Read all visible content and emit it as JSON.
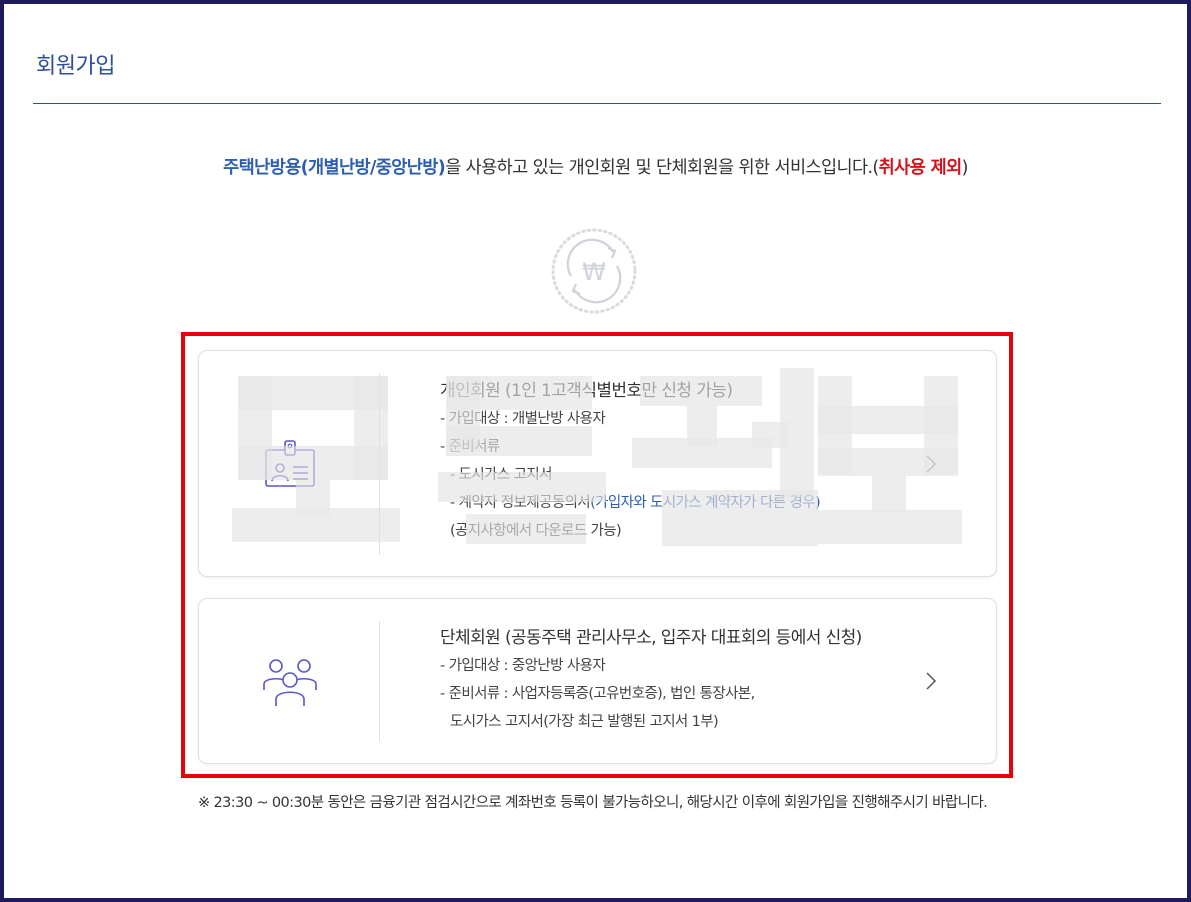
{
  "page": {
    "title": "회원가입"
  },
  "intro": {
    "highlight_blue": "주택난방용(개별난방/중앙난방)",
    "text_middle": "을 사용하고 있는 개인회원 및 단체회원을 위한 서비스입니다.(",
    "highlight_red": "취사용 제외",
    "text_end": ")"
  },
  "icons": {
    "won": "won-currency-icon",
    "individual": "id-badge-icon",
    "group": "group-users-icon",
    "chevron": "chevron-right-icon"
  },
  "individual_card": {
    "heading": "개인회원 (1인 1고객식별번호만 신청 가능)",
    "target": "- 가입대상 : 개별난방 사용자",
    "docs_label": "- 준비서류",
    "doc1": "- 도시가스 고지서",
    "doc2_prefix": "- 계약자 정보제공동의서",
    "doc2_highlight": "(가입자와 도시가스 계약자가 다른 경우)",
    "doc2_note": "(공지사항에서 다운로드 가능)"
  },
  "group_card": {
    "heading": "단체회원 (공동주택 관리사무소, 입주자 대표회의 등에서 신청)",
    "target": "- 가입대상 : 중앙난방 사용자",
    "docs_line1": "- 준비서류 : 사업자등록증(고유번호증), 법인 통장사본,",
    "docs_line2": "도시가스 고지서(가장 최근 발행된 고지서 1부)"
  },
  "notice": {
    "text": "※ 23:30 ~ 00:30분 동안은 금융기관 점검시간으로 계좌번호 등록이 불가능하오니, 해당시간 이후에 회원가입을 진행해주시기 바랍니다."
  },
  "colors": {
    "frame": "#1e1a5c",
    "title_blue": "#2d4f9c",
    "accent_blue": "#2d5fb0",
    "accent_red": "#d4121b",
    "highlight_border": "#e8000b",
    "icon_purple": "#5b57c7"
  }
}
